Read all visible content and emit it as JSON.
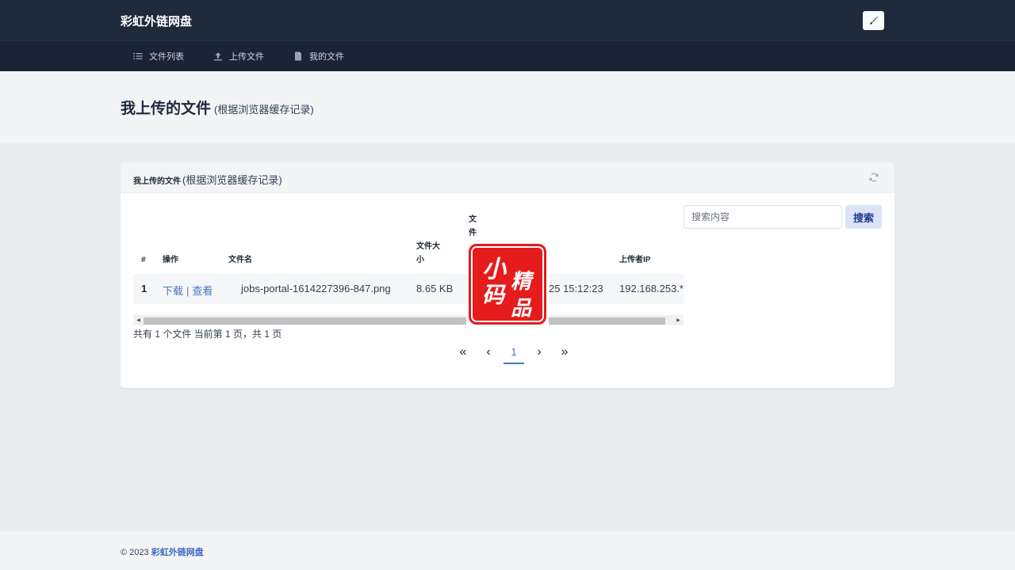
{
  "app": {
    "brand": "彩虹外链网盘"
  },
  "nav": {
    "items": [
      {
        "label": "文件列表",
        "icon": "list-icon"
      },
      {
        "label": "上传文件",
        "icon": "upload-icon"
      },
      {
        "label": "我的文件",
        "icon": "file-icon"
      }
    ]
  },
  "page": {
    "title": "我上传的文件",
    "subtitle": "(根据浏览器缓存记录)"
  },
  "card": {
    "title": "我上传的文件",
    "subtitle": "(根据浏览器缓存记录)",
    "search": {
      "placeholder": "搜索内容",
      "button": "搜索"
    },
    "table": {
      "headers": {
        "index": "#",
        "actions": "操作",
        "filename": "文件名",
        "size_l1": "文件大",
        "size_l2": "小",
        "type_l1": "文",
        "type_l2": "件",
        "uploader_ip": "上传者IP"
      },
      "rows": [
        {
          "index": "1",
          "download": "下载",
          "divider": "|",
          "view": "查看",
          "filename": "jobs-portal-1614227396-847.png",
          "size": "8.65 KB",
          "time": "25 15:12:23",
          "ip": "192.168.253.*"
        }
      ]
    },
    "summary": "共有 1 个文件  当前第 1 页，共 1 页",
    "pagination": {
      "first": "«",
      "prev": "‹",
      "current": "1",
      "next": "›",
      "last": "»"
    }
  },
  "watermark": {
    "chars": [
      "小",
      "精",
      "码",
      "品"
    ]
  },
  "footer": {
    "copyright": "© 2023",
    "link": "彩虹外链网盘"
  },
  "colors": {
    "header_bg": "#1e293b",
    "accent": "#4576c6",
    "seal_red": "#e61b1b"
  }
}
